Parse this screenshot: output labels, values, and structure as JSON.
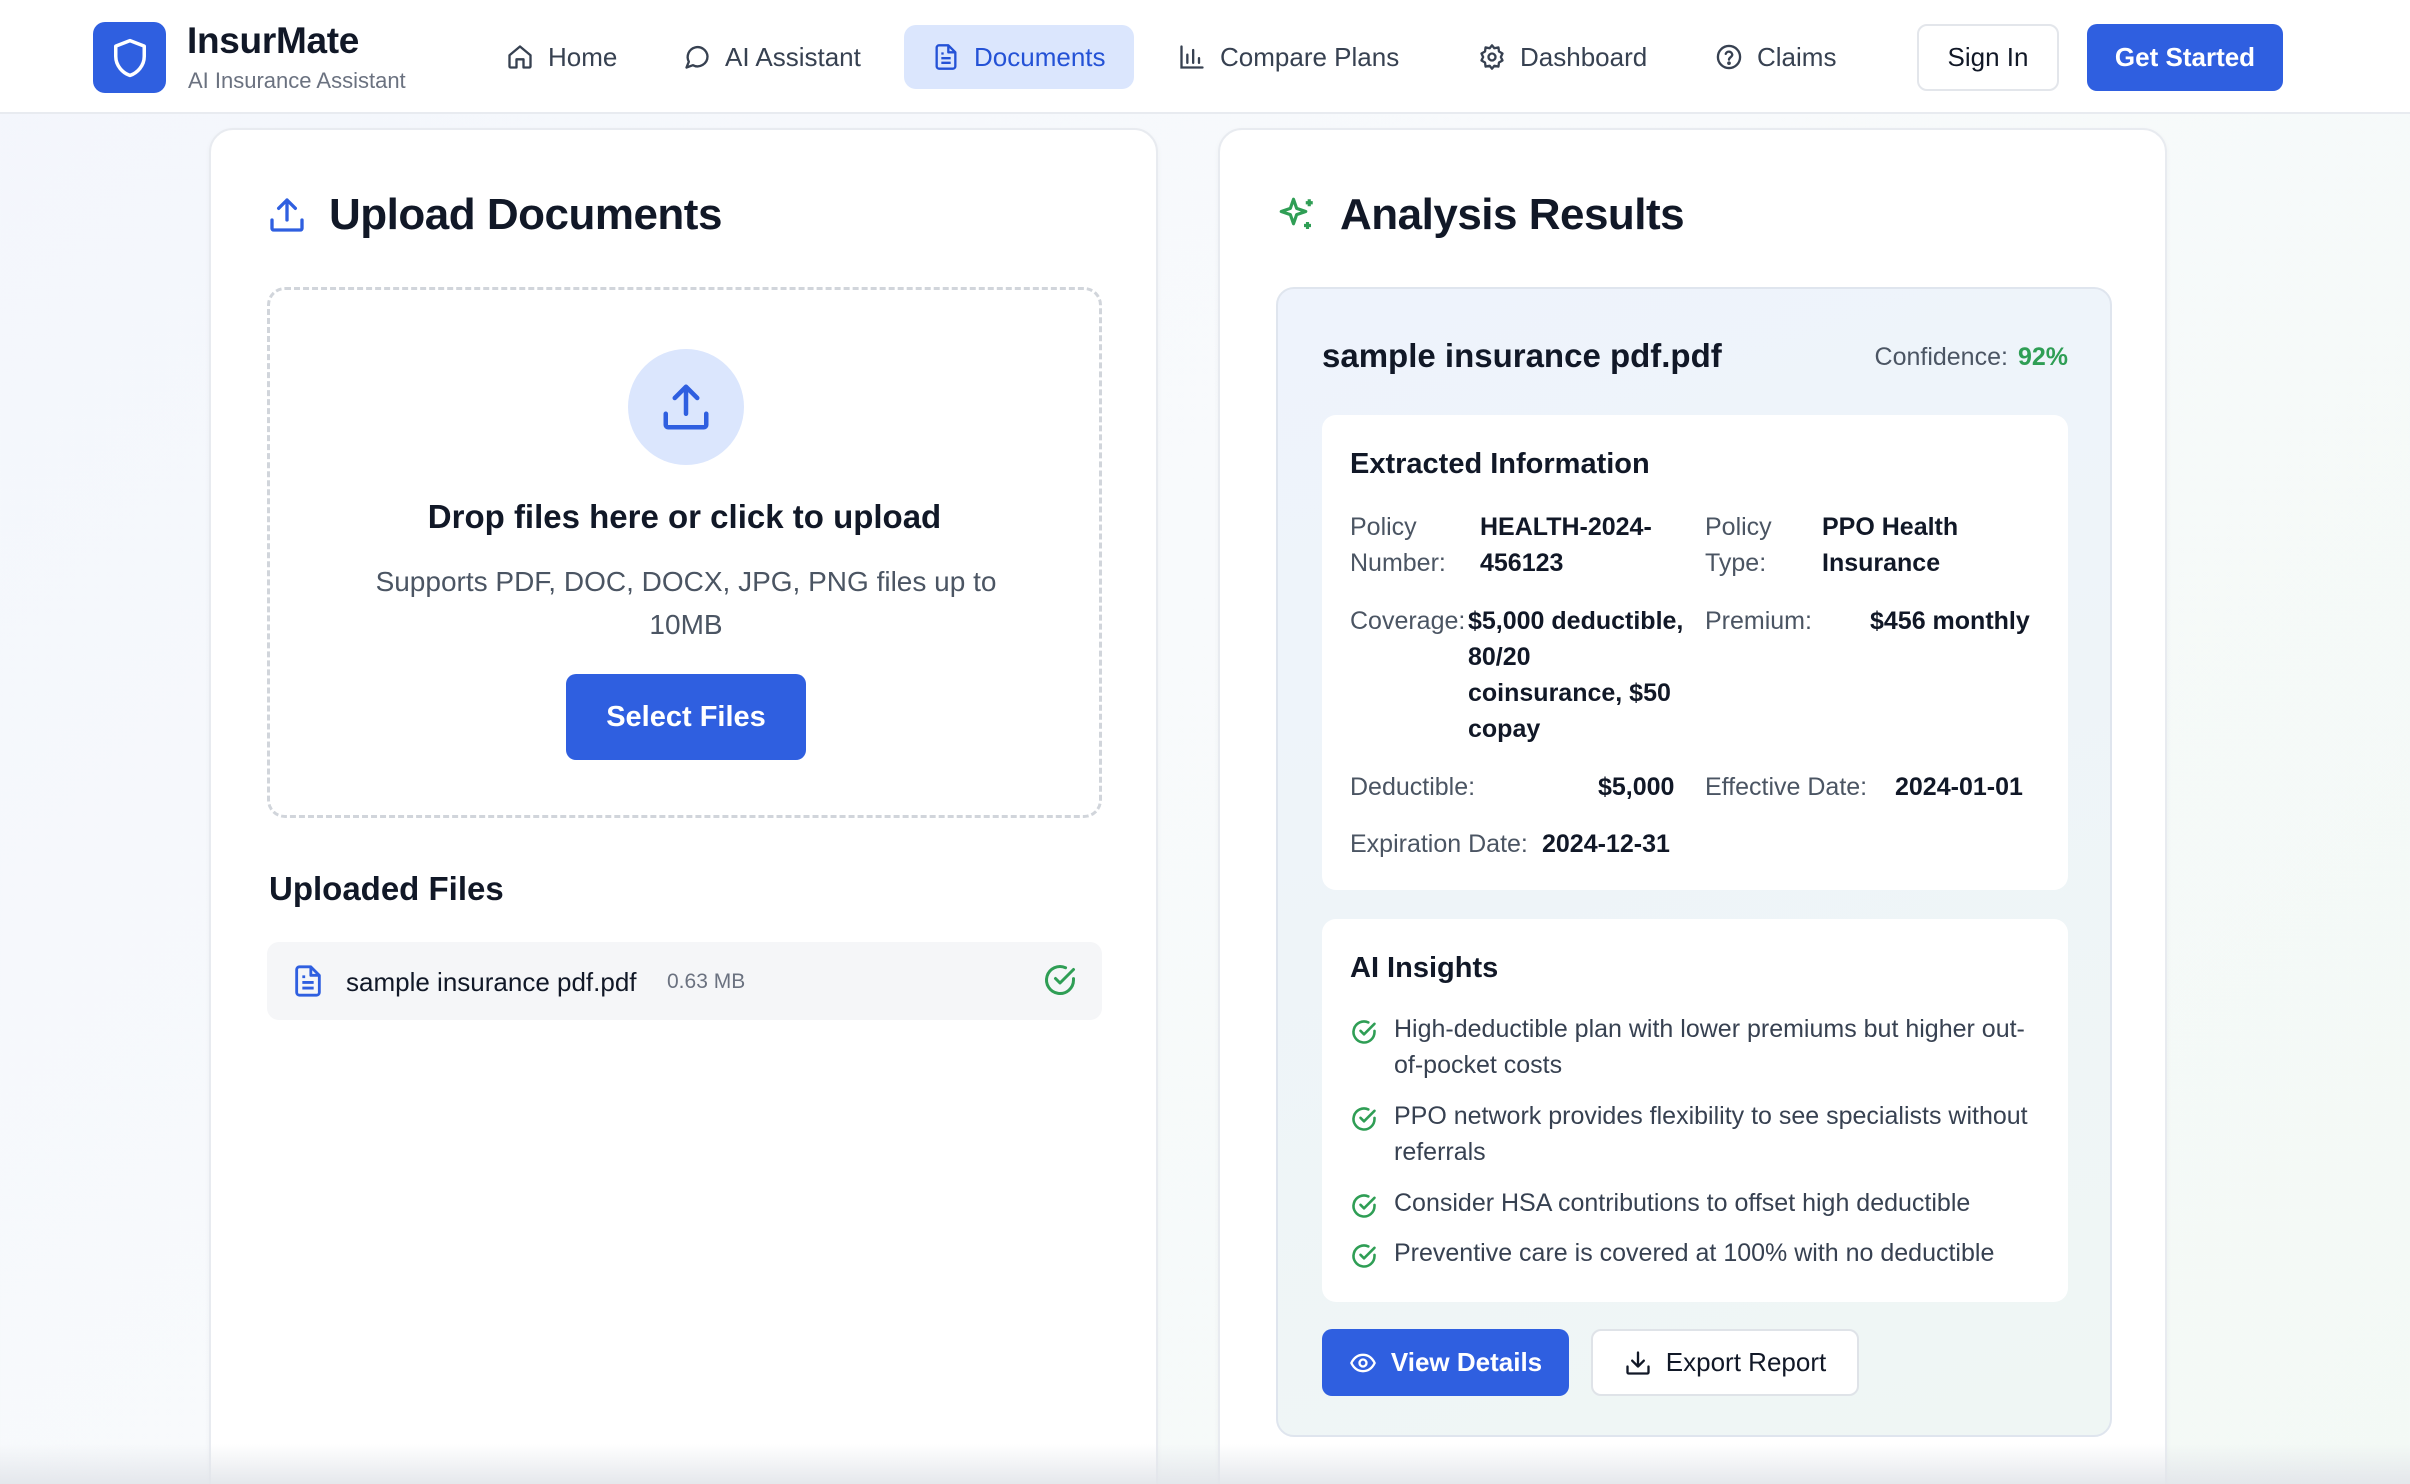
{
  "brand": {
    "name": "InsurMate",
    "tagline": "AI Insurance Assistant",
    "accent": "#2f5fe0"
  },
  "nav": {
    "items": [
      {
        "label": "Home",
        "icon": "home-icon",
        "active": false
      },
      {
        "label": "AI Assistant",
        "icon": "chat-bubble-icon",
        "active": false
      },
      {
        "label": "Documents",
        "icon": "document-icon",
        "active": true
      },
      {
        "label": "Compare Plans",
        "icon": "bar-chart-icon",
        "active": false
      },
      {
        "label": "Dashboard",
        "icon": "gear-icon",
        "active": false
      },
      {
        "label": "Claims",
        "icon": "help-circle-icon",
        "active": false
      }
    ],
    "sign_in": "Sign In",
    "get_started": "Get Started"
  },
  "upload": {
    "title": "Upload Documents",
    "drop_title": "Drop files here or click to upload",
    "drop_subtitle": "Supports PDF, DOC, DOCX, JPG, PNG files up to 10MB",
    "select_button": "Select Files",
    "uploaded_title": "Uploaded Files",
    "files": [
      {
        "name": "sample insurance pdf.pdf",
        "size": "0.63 MB",
        "status": "complete"
      }
    ]
  },
  "analysis": {
    "title": "Analysis Results",
    "file_name": "sample insurance pdf.pdf",
    "confidence_label": "Confidence:",
    "confidence_value": "92%",
    "success_color": "#2f9e55",
    "extracted": {
      "title": "Extracted Information",
      "fields": [
        {
          "label": "Policy Number:",
          "value": "HEALTH-2024-456123"
        },
        {
          "label": "Policy Type:",
          "value": "PPO Health Insurance"
        },
        {
          "label": "Coverage:",
          "value": "$5,000 deductible, 80/20 coinsurance, $50 copay"
        },
        {
          "label": "Premium:",
          "value": "$456 monthly"
        },
        {
          "label": "Deductible:",
          "value": "$5,000"
        },
        {
          "label": "Effective Date:",
          "value": "2024-01-01"
        },
        {
          "label": "Expiration Date:",
          "value": "2024-12-31"
        }
      ]
    },
    "insights": {
      "title": "AI Insights",
      "items": [
        "High-deductible plan with lower premiums but higher out-of-pocket costs",
        "PPO network provides flexibility to see specialists without referrals",
        "Consider HSA contributions to offset high deductible",
        "Preventive care is covered at 100% with no deductible"
      ]
    },
    "view_button": "View Details",
    "export_button": "Export Report"
  }
}
